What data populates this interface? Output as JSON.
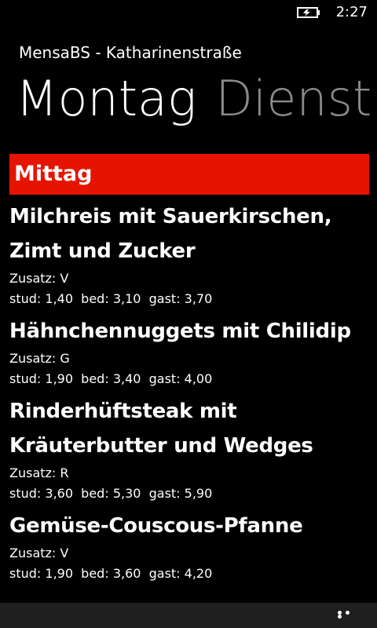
{
  "status_bar": {
    "battery_icon": "battery-charging-icon",
    "time": "2:27"
  },
  "app": {
    "title": "MensaBS - Katharinenstraße"
  },
  "pivot": {
    "active": "Montag",
    "next": "Dienst"
  },
  "section": {
    "header": "Mittag",
    "header_color": "#e51400",
    "meals": [
      {
        "name": "Milchreis mit Sauerkirschen, Zimt und Zucker",
        "zusatz": "Zusatz: V",
        "prices": "stud: 1,40  bed: 3,10  gast: 3,70"
      },
      {
        "name": "Hähnchennuggets mit Chilidip",
        "zusatz": "Zusatz: G",
        "prices": "stud: 1,90  bed: 3,40  gast: 4,00"
      },
      {
        "name": "Rinderhüftsteak mit Kräuterbutter und Wedges",
        "zusatz": "Zusatz: R",
        "prices": "stud: 3,60  bed: 5,30  gast: 5,90"
      },
      {
        "name": "Gemüse-Couscous-Pfanne",
        "zusatz": "Zusatz: V",
        "prices": "stud: 1,90  bed: 3,60  gast: 4,20"
      }
    ]
  },
  "app_bar": {
    "more_icon": "ellipsis-icon"
  }
}
